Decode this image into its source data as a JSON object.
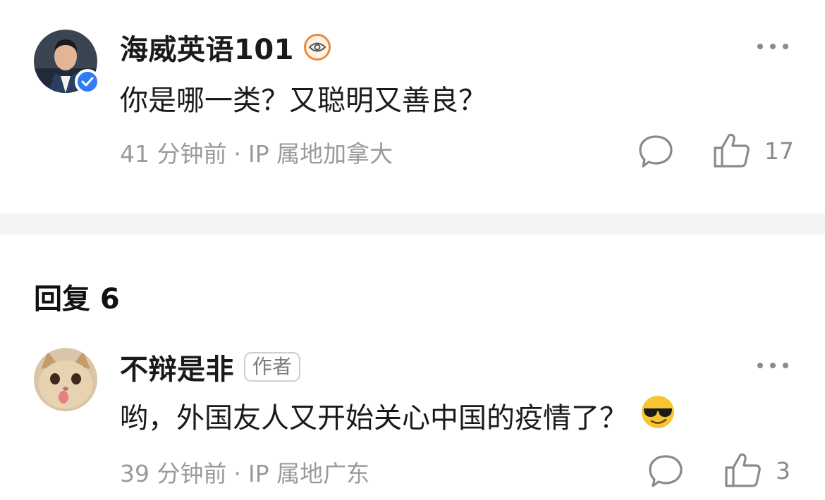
{
  "comment1": {
    "username": "海威英语101",
    "text": "你是哪一类？又聪明又善良？",
    "time": "41 分钟前",
    "separator": "·",
    "location": "IP 属地加拿大",
    "likes": "17",
    "avatar_icon": "man-portrait-avatar",
    "badge_icon": "eye-badge-icon",
    "verified_icon": "verified-check-icon"
  },
  "replies_header": {
    "label": "回复 6"
  },
  "comment2": {
    "username": "不辩是非",
    "author_tag": "作者",
    "text": "哟，外国友人又开始关心中国的疫情了？",
    "emoji_icon": "sunglasses-emoji-icon",
    "time": "39 分钟前",
    "separator": "·",
    "location": "IP 属地广东",
    "likes": "3",
    "avatar_icon": "cat-avatar"
  },
  "colors": {
    "verified_blue": "#2f7cf6",
    "eye_badge_orange": "#e88b3a",
    "meta_gray": "#9a9a9a",
    "divider": "#f4f4f4"
  }
}
